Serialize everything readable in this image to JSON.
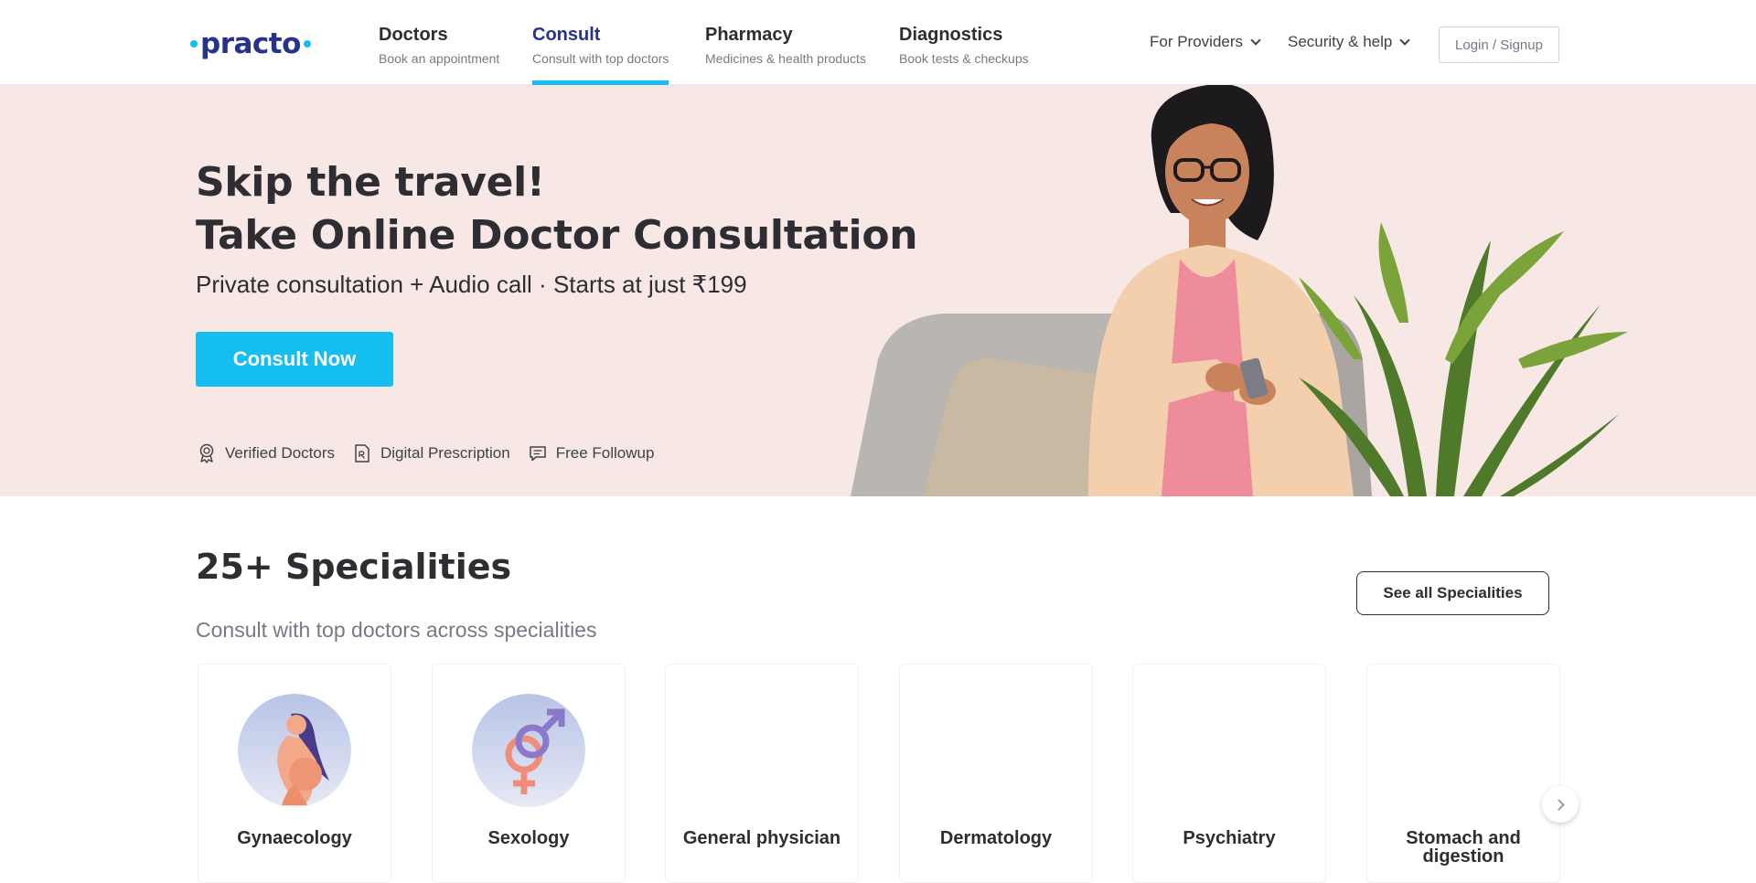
{
  "header": {
    "logo": "practo",
    "nav": [
      {
        "title": "Doctors",
        "subtitle": "Book an appointment"
      },
      {
        "title": "Consult",
        "subtitle": "Consult with top doctors"
      },
      {
        "title": "Pharmacy",
        "subtitle": "Medicines & health products"
      },
      {
        "title": "Diagnostics",
        "subtitle": "Book tests & checkups"
      }
    ],
    "providers_label": "For Providers",
    "security_label": "Security & help",
    "login_label": "Login / Signup"
  },
  "hero": {
    "heading_line1": "Skip the travel!",
    "heading_line2": "Take Online Doctor Consultation",
    "subtitle": "Private consultation + Audio call · Starts at just ₹199",
    "cta_label": "Consult Now",
    "features": [
      {
        "icon": "verified-badge-icon",
        "label": "Verified Doctors"
      },
      {
        "icon": "prescription-icon",
        "label": "Digital Prescription"
      },
      {
        "icon": "chat-icon",
        "label": "Free Followup"
      }
    ]
  },
  "specialities": {
    "title": "25+ Specialities",
    "subtitle": "Consult with top doctors across specialities",
    "see_all_label": "See all Specialities",
    "items": [
      {
        "label": "Gynaecology",
        "icon": "pregnant-woman-icon"
      },
      {
        "label": "Sexology",
        "icon": "gender-symbols-icon"
      },
      {
        "label": "General physician",
        "icon": ""
      },
      {
        "label": "Dermatology",
        "icon": ""
      },
      {
        "label": "Psychiatry",
        "icon": ""
      },
      {
        "label": "Stomach and digestion",
        "icon": ""
      }
    ]
  },
  "colors": {
    "brand_navy": "#28328c",
    "brand_cyan": "#14bef0",
    "hero_bg": "#f7e8e6"
  }
}
